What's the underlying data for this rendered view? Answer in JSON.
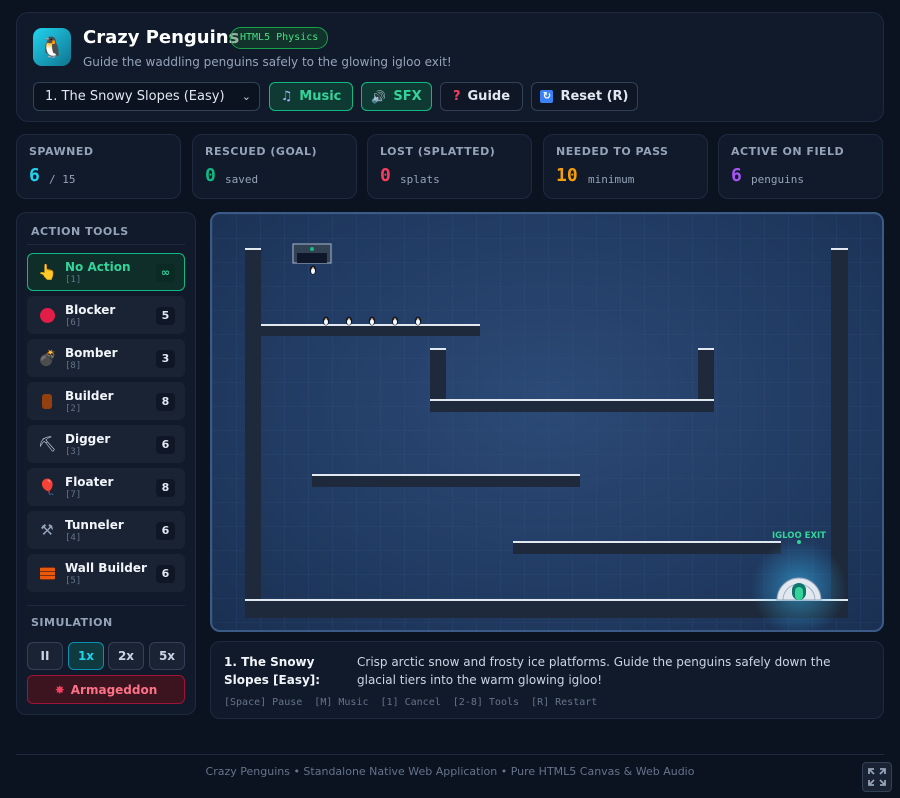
{
  "header": {
    "logo_icon": "penguin-emoji",
    "logo_glyph": "🐧",
    "title": "Crazy Penguins",
    "badge": "HTML5 Physics",
    "subtitle": "Guide the waddling penguins safely to the glowing igloo exit!",
    "level_select": "1. The Snowy Slopes (Easy)",
    "buttons": {
      "music": "Music",
      "sfx": "SFX",
      "guide": "Guide",
      "reset": "Reset (R)"
    }
  },
  "stats": [
    {
      "label": "SPAWNED",
      "value": "6",
      "unit": "/ 15",
      "color": "#22d3ee"
    },
    {
      "label": "RESCUED (GOAL)",
      "value": "0",
      "unit": "saved",
      "color": "#10b981"
    },
    {
      "label": "LOST (SPLATTED)",
      "value": "0",
      "unit": "splats",
      "color": "#f43f5e"
    },
    {
      "label": "NEEDED TO PASS",
      "value": "10",
      "unit": "minimum",
      "color": "#f59e0b"
    },
    {
      "label": "ACTIVE ON FIELD",
      "value": "6",
      "unit": "penguins",
      "color": "#a855f7"
    }
  ],
  "tools": {
    "section_label": "ACTION TOOLS",
    "items": [
      {
        "name": "No Action",
        "key": "[1]",
        "count": "∞",
        "icon": "pointer-hand-icon"
      },
      {
        "name": "Blocker",
        "key": "[6]",
        "count": "5",
        "icon": "stop-circle-icon"
      },
      {
        "name": "Bomber",
        "key": "[8]",
        "count": "3",
        "icon": "bomb-icon"
      },
      {
        "name": "Builder",
        "key": "[2]",
        "count": "8",
        "icon": "wood-log-icon"
      },
      {
        "name": "Digger",
        "key": "[3]",
        "count": "6",
        "icon": "pickaxe-icon"
      },
      {
        "name": "Floater",
        "key": "[7]",
        "count": "8",
        "icon": "balloon-icon"
      },
      {
        "name": "Tunneler",
        "key": "[4]",
        "count": "6",
        "icon": "drill-icon"
      },
      {
        "name": "Wall Builder",
        "key": "[5]",
        "count": "6",
        "icon": "brick-icon"
      }
    ]
  },
  "simulation": {
    "section_label": "SIMULATION",
    "pause": "II",
    "speed_1x": "1x",
    "speed_2x": "2x",
    "speed_5x": "5x",
    "armageddon": "Armageddon"
  },
  "game": {
    "exit_label": "IGLOO EXIT",
    "penguins_on_field": 6
  },
  "info": {
    "level_name": "1. The Snowy Slopes [Easy]:",
    "description": "Crisp arctic snow and frosty ice platforms. Guide the penguins safely down the glacial tiers into the warm glowing igloo!",
    "shortcuts": "[Space] Pause  [M] Music  [1] Cancel  [2-8] Tools  [R] Restart"
  },
  "footer": "Crazy Penguins • Standalone Native Web Application • Pure HTML5 Canvas & Web Audio",
  "colors": {
    "accent_green": "#10b981",
    "accent_cyan": "#22d3ee",
    "danger": "#f43f5e"
  }
}
